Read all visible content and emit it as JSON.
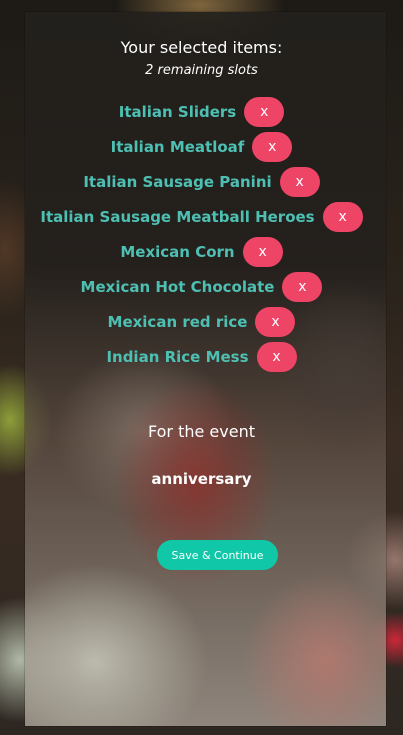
{
  "header": {
    "title": "Your selected items:",
    "subtitle": "2 remaining slots"
  },
  "items": [
    {
      "label": "Italian Sliders",
      "remove_label": "x"
    },
    {
      "label": "Italian Meatloaf",
      "remove_label": "x"
    },
    {
      "label": "Italian Sausage Panini",
      "remove_label": "x"
    },
    {
      "label": "Italian Sausage Meatball Heroes",
      "remove_label": "x"
    },
    {
      "label": "Mexican Corn",
      "remove_label": "x"
    },
    {
      "label": "Mexican Hot Chocolate",
      "remove_label": "x"
    },
    {
      "label": "Mexican red rice",
      "remove_label": "x"
    },
    {
      "label": "Indian Rice Mess",
      "remove_label": "x"
    }
  ],
  "event": {
    "label": "For the event",
    "name": "anniversary"
  },
  "actions": {
    "continue_label": "Save & Continue"
  },
  "colors": {
    "item_text": "#4ec0b3",
    "remove_button": "#ee4466",
    "continue_button": "#10c8a8"
  }
}
